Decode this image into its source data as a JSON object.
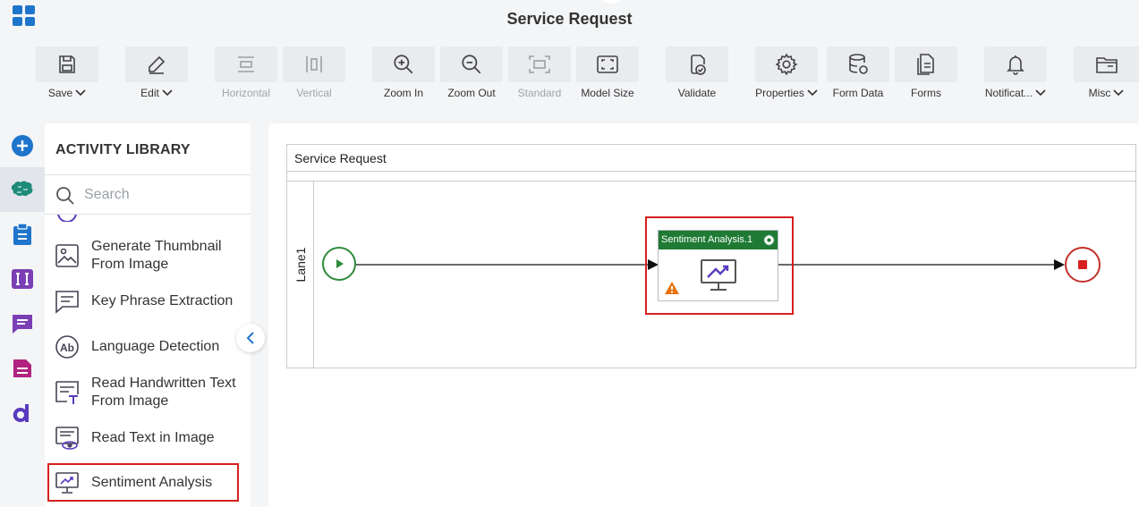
{
  "app": {
    "title": "Service Request"
  },
  "toolbar": {
    "save": "Save",
    "edit": "Edit",
    "horizontal": "Horizontal",
    "vertical": "Vertical",
    "zoom_in": "Zoom In",
    "zoom_out": "Zoom Out",
    "standard": "Standard",
    "model_size": "Model Size",
    "validate": "Validate",
    "properties": "Properties",
    "form_data": "Form Data",
    "forms": "Forms",
    "notifications": "Notificat...",
    "misc": "Misc"
  },
  "library": {
    "title": "ACTIVITY LIBRARY",
    "search_placeholder": "Search",
    "items": [
      {
        "label": "Generate Thumbnail From Image",
        "icon": "image-thumbnail-icon"
      },
      {
        "label": "Key Phrase Extraction",
        "icon": "key-phrase-icon"
      },
      {
        "label": "Language Detection",
        "icon": "language-detection-icon"
      },
      {
        "label": "Read Handwritten Text From Image",
        "icon": "handwritten-text-icon"
      },
      {
        "label": "Read Text in Image",
        "icon": "read-text-image-icon"
      },
      {
        "label": "Sentiment Analysis",
        "icon": "sentiment-analysis-icon"
      }
    ]
  },
  "canvas": {
    "pool_name": "Service Request",
    "lane_name": "Lane1",
    "activity_title": "Sentiment Analysis.1"
  },
  "colors": {
    "accent_blue": "#1f75cb",
    "activity_green": "#1f7a34",
    "highlight_red": "#d71f1f",
    "start_green": "#2e8b3c",
    "warning_orange": "#e8710a"
  }
}
